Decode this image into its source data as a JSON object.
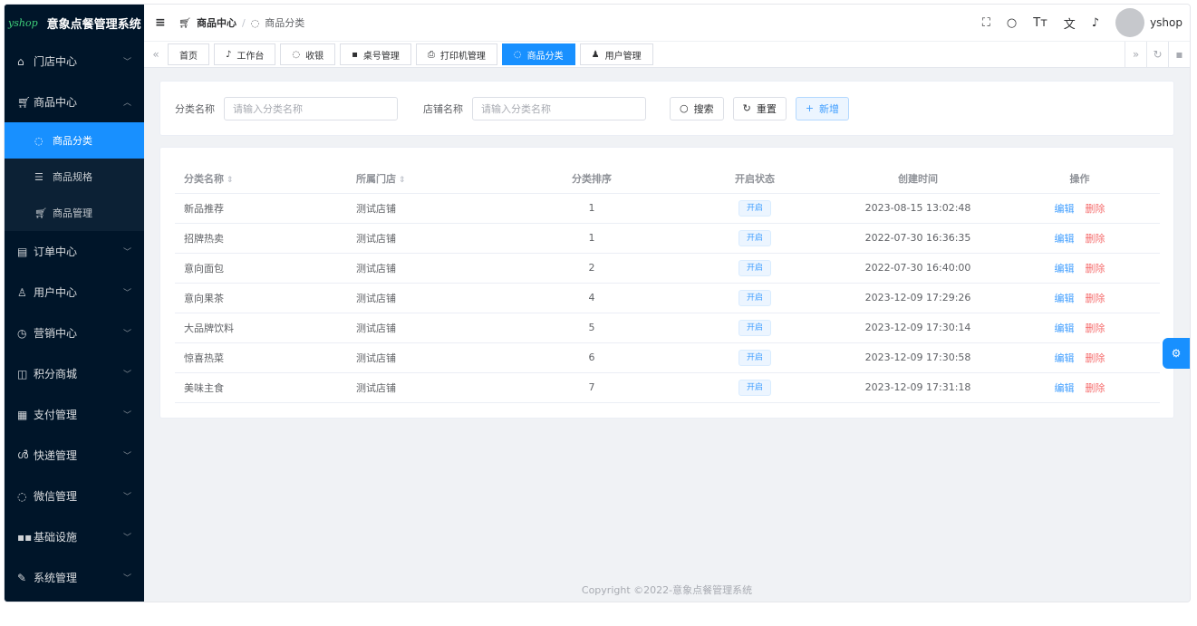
{
  "brand": {
    "logo": "yshop",
    "title": "意象点餐管理系统"
  },
  "sidebar": {
    "groups_top": [
      {
        "label": "门店中心",
        "icon": "home-icon",
        "arrow": "chevron-down"
      }
    ],
    "active_group": {
      "label": "商品中心",
      "icon": "cart-icon",
      "arrow": "chevron-up"
    },
    "sub_items": [
      {
        "label": "商品分类",
        "icon": "chat-icon",
        "active": true
      },
      {
        "label": "商品规格",
        "icon": "sliders-icon",
        "active": false
      },
      {
        "label": "商品管理",
        "icon": "cart-icon",
        "active": false
      }
    ],
    "groups_bottom": [
      {
        "label": "订单中心",
        "icon": "clipboard-icon"
      },
      {
        "label": "用户中心",
        "icon": "user-icon"
      },
      {
        "label": "营销中心",
        "icon": "clock-icon"
      },
      {
        "label": "积分商城",
        "icon": "bag-icon"
      },
      {
        "label": "支付管理",
        "icon": "grid-icon"
      },
      {
        "label": "快递管理",
        "icon": "bike-icon"
      },
      {
        "label": "微信管理",
        "icon": "chat-icon"
      },
      {
        "label": "基础设施",
        "icon": "apps-icon"
      },
      {
        "label": "系统管理",
        "icon": "tools-icon"
      }
    ]
  },
  "header": {
    "breadcrumb": {
      "first": "商品中心",
      "second": "商品分类"
    },
    "username": "yshop"
  },
  "tabs": [
    {
      "label": "首页",
      "icon": "",
      "active": false
    },
    {
      "label": "工作台",
      "icon": "bell-icon",
      "active": false
    },
    {
      "label": "收银",
      "icon": "chat-icon",
      "active": false
    },
    {
      "label": "桌号管理",
      "icon": "apps-icon",
      "active": false
    },
    {
      "label": "打印机管理",
      "icon": "printer-icon",
      "active": false
    },
    {
      "label": "商品分类",
      "icon": "chat-icon",
      "active": true
    },
    {
      "label": "用户管理",
      "icon": "user-icon",
      "active": false
    }
  ],
  "search": {
    "category_label": "分类名称",
    "category_placeholder": "请输入分类名称",
    "shop_label": "店铺名称",
    "shop_placeholder": "请输入分类名称",
    "search_btn": "搜索",
    "reset_btn": "重置",
    "add_btn": "新增"
  },
  "table": {
    "columns": [
      "分类名称",
      "所属门店",
      "分类排序",
      "开启状态",
      "创建时间",
      "操作"
    ],
    "edit_label": "编辑",
    "delete_label": "删除",
    "rows": [
      {
        "name": "新品推荐",
        "shop": "测试店铺",
        "sort": "1",
        "status": "开启",
        "created": "2023-08-15 13:02:48"
      },
      {
        "name": "招牌热卖",
        "shop": "测试店铺",
        "sort": "1",
        "status": "开启",
        "created": "2022-07-30 16:36:35"
      },
      {
        "name": "意向面包",
        "shop": "测试店铺",
        "sort": "2",
        "status": "开启",
        "created": "2022-07-30 16:40:00"
      },
      {
        "name": "意向果茶",
        "shop": "测试店铺",
        "sort": "4",
        "status": "开启",
        "created": "2023-12-09 17:29:26"
      },
      {
        "name": "大品牌饮料",
        "shop": "测试店铺",
        "sort": "5",
        "status": "开启",
        "created": "2023-12-09 17:30:14"
      },
      {
        "name": "惊喜热菜",
        "shop": "测试店铺",
        "sort": "6",
        "status": "开启",
        "created": "2023-12-09 17:30:58"
      },
      {
        "name": "美味主食",
        "shop": "测试店铺",
        "sort": "7",
        "status": "开启",
        "created": "2023-12-09 17:31:18"
      }
    ]
  },
  "footer": {
    "copyright": "Copyright ©2022-意象点餐管理系统"
  },
  "colors": {
    "accent": "#1890ff",
    "sidebar_bg": "#001529",
    "danger": "#f56c6c",
    "link": "#409eff"
  }
}
